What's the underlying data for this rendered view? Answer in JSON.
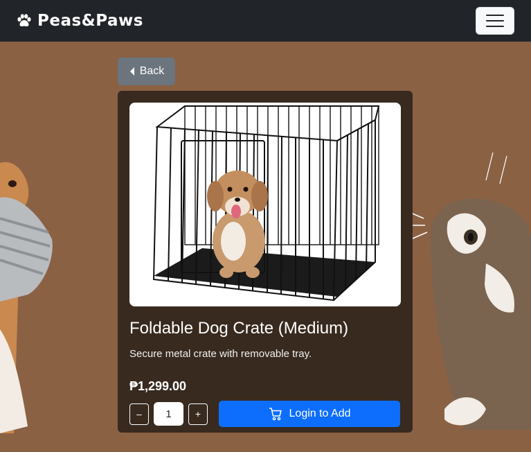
{
  "navbar": {
    "brand_text": "Peas&Paws",
    "brand_icon": "paw-icon",
    "menu_icon": "hamburger-icon"
  },
  "back_button": {
    "label": "Back",
    "icon": "caret-left-icon"
  },
  "product": {
    "title": "Foldable Dog Crate (Medium)",
    "description": "Secure metal crate with removable tray.",
    "price": "₱1,299.00",
    "quantity": "1",
    "decrement_label": "–",
    "increment_label": "+",
    "add_button_label": "Login to Add",
    "add_button_icon": "cart-icon"
  },
  "colors": {
    "background": "#8b6144",
    "navbar": "#212529",
    "card": "#382a1f",
    "accent": "#0d6efd",
    "back_button": "#6c757d"
  }
}
